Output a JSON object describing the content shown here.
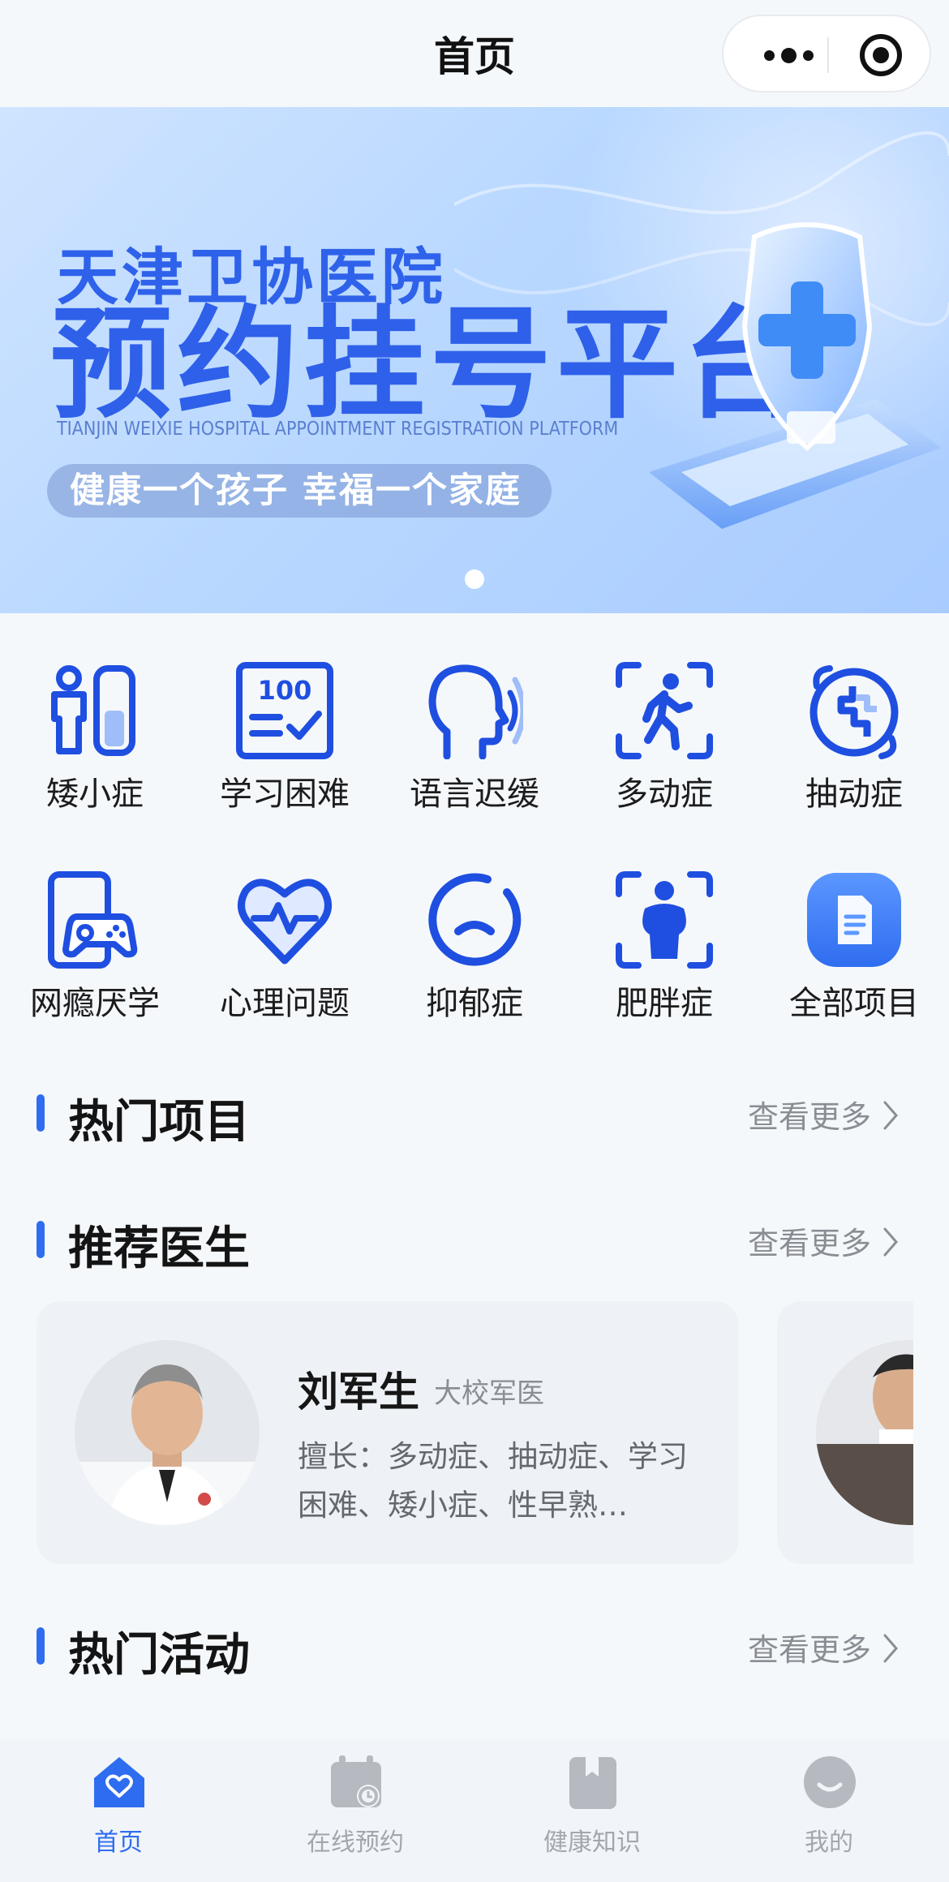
{
  "topbar": {
    "title": "首页",
    "menu_icon": "more-dots-icon",
    "close_icon": "target-circle-icon"
  },
  "banner": {
    "subtitle": "天津卫协医院",
    "headline": "预约挂号平台",
    "english": "TIANJIN WEIXIE HOSPITAL APPOINTMENT REGISTRATION PLATFORM",
    "slogan": "健康一个孩子 幸福一个家庭",
    "slide_count": 1,
    "active_slide": 1
  },
  "categories": [
    {
      "label": "矮小症",
      "icon": "height-chart-icon"
    },
    {
      "label": "学习困难",
      "icon": "test-paper-icon"
    },
    {
      "label": "语言迟缓",
      "icon": "speaking-head-icon"
    },
    {
      "label": "多动症",
      "icon": "running-person-icon"
    },
    {
      "label": "抽动症",
      "icon": "twitch-icon"
    },
    {
      "label": "网瘾厌学",
      "icon": "phone-gamepad-icon"
    },
    {
      "label": "心理问题",
      "icon": "heart-pulse-icon"
    },
    {
      "label": "抑郁症",
      "icon": "sad-face-icon"
    },
    {
      "label": "肥胖症",
      "icon": "body-scan-icon"
    },
    {
      "label": "全部项目",
      "icon": "document-icon"
    }
  ],
  "sections": {
    "hot_projects": {
      "title": "热门项目",
      "more": "查看更多"
    },
    "recommended_doctors": {
      "title": "推荐医生",
      "more": "查看更多"
    },
    "hot_events": {
      "title": "热门活动",
      "more": "查看更多"
    }
  },
  "doctors": [
    {
      "name": "刘军生",
      "rank": "大校军医",
      "skill": "擅长：多动症、抽动症、学习困难、矮小症、性早熟…"
    }
  ],
  "tabbar": [
    {
      "label": "首页",
      "icon": "home-heart-icon",
      "active": true
    },
    {
      "label": "在线预约",
      "icon": "calendar-clock-icon",
      "active": false
    },
    {
      "label": "健康知识",
      "icon": "book-icon",
      "active": false
    },
    {
      "label": "我的",
      "icon": "smile-face-icon",
      "active": false
    }
  ],
  "colors": {
    "accent": "#2f6df0",
    "icon_blue": "#1f4fe0",
    "background": "#f5f8fb",
    "muted_text": "#8a8d93"
  }
}
